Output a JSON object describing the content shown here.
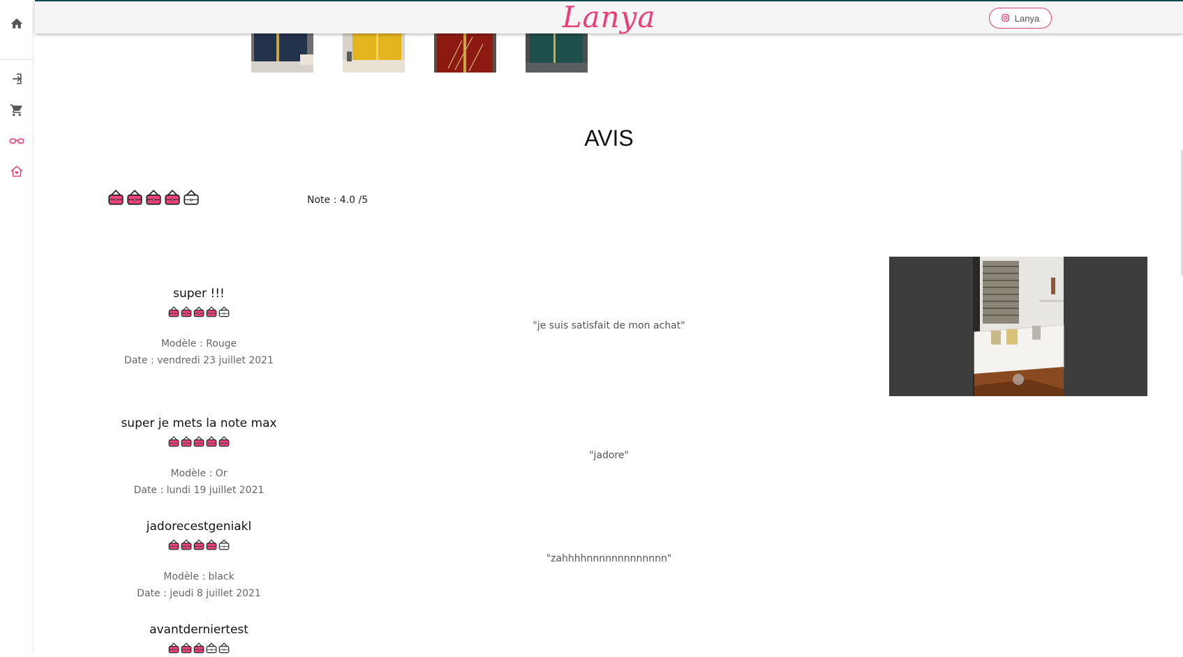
{
  "header": {
    "logo": "Lanya",
    "instagram_label": "Lanya"
  },
  "sidebar": {
    "items": [
      {
        "name": "home",
        "icon": "home-icon"
      },
      {
        "name": "login",
        "icon": "login-icon"
      },
      {
        "name": "cart",
        "icon": "cart-icon"
      },
      {
        "name": "glasses",
        "icon": "glasses-icon"
      },
      {
        "name": "house-heart",
        "icon": "house-heart-icon"
      }
    ]
  },
  "colors": {
    "accent": "#ec3d78",
    "bag_fill": "#f0437e",
    "photo_bg": "#3d3d3c"
  },
  "thumbnails": [
    {
      "color_name": "navy"
    },
    {
      "color_name": "yellow"
    },
    {
      "color_name": "red"
    },
    {
      "color_name": "green"
    }
  ],
  "reviews_section": {
    "title": "AVIS",
    "overall_rating": 4.0,
    "note_text": "Note : 4.0 /5"
  },
  "reviews": [
    {
      "title": "super !!!",
      "rating": 4,
      "model": "Modèle : Rouge",
      "date": "Date : vendredi 23 juillet 2021",
      "text": "\"je suis satisfait de mon achat\""
    },
    {
      "title": "super je mets la note max",
      "rating": 5,
      "model": "Modèle : Or",
      "date": "Date : lundi 19 juillet 2021",
      "text": "\"jadore\""
    },
    {
      "title": "jadorecestgeniakl",
      "rating": 4,
      "model": "Modèle : black",
      "date": "Date : jeudi 8 juillet 2021",
      "text": "\"zahhhhnnnnnnnnnnnnn\""
    },
    {
      "title": "avantderniertest",
      "rating": 3
    }
  ]
}
